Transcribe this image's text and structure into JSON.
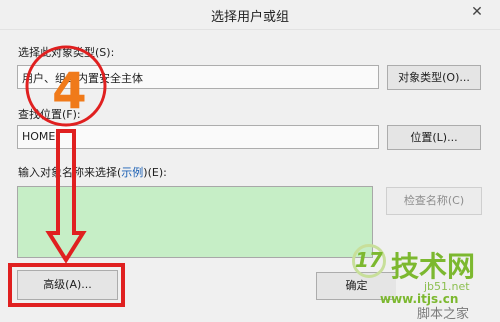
{
  "window": {
    "title": "选择用户或组",
    "close_glyph": "✕"
  },
  "object_type": {
    "label": "选择此对象类型(S):",
    "value": "用户、组或内置安全主体",
    "button": "对象类型(O)..."
  },
  "location": {
    "label": "查找位置(F):",
    "value": "HOME",
    "button": "位置(L)..."
  },
  "names": {
    "label_prefix": "输入对象名称来选择(",
    "label_link": "示例",
    "label_suffix": ")(E):",
    "value": "",
    "check_button": "检查名称(C)"
  },
  "footer": {
    "advanced_button": "高级(A)...",
    "ok_button": "确定"
  },
  "annotation": {
    "step_number": "4",
    "circle_color": "#e02020",
    "number_color": "#f07a1a",
    "arrow_color": "#e02020",
    "box_color": "#e02020"
  },
  "watermark": {
    "brand_number": "17",
    "brand_text": "技术网",
    "url1": "jb51.net",
    "url2": "www.itjs.cn",
    "footer_text": "脚本之家",
    "color": "#7cb82f"
  }
}
